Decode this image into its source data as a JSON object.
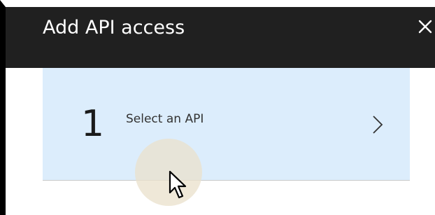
{
  "blade": {
    "title": "Add API access",
    "close_icon": "close-icon"
  },
  "steps": [
    {
      "number": "1",
      "label": "Select an API",
      "icon": "chevron-right-icon",
      "state": "hover"
    }
  ],
  "cursor": {
    "icon": "mouse-cursor-icon"
  },
  "colors": {
    "header_bg": "#202020",
    "header_text": "#ffffff",
    "step_bg": "#dcedfc",
    "click_ripple": "#eae1cd"
  }
}
